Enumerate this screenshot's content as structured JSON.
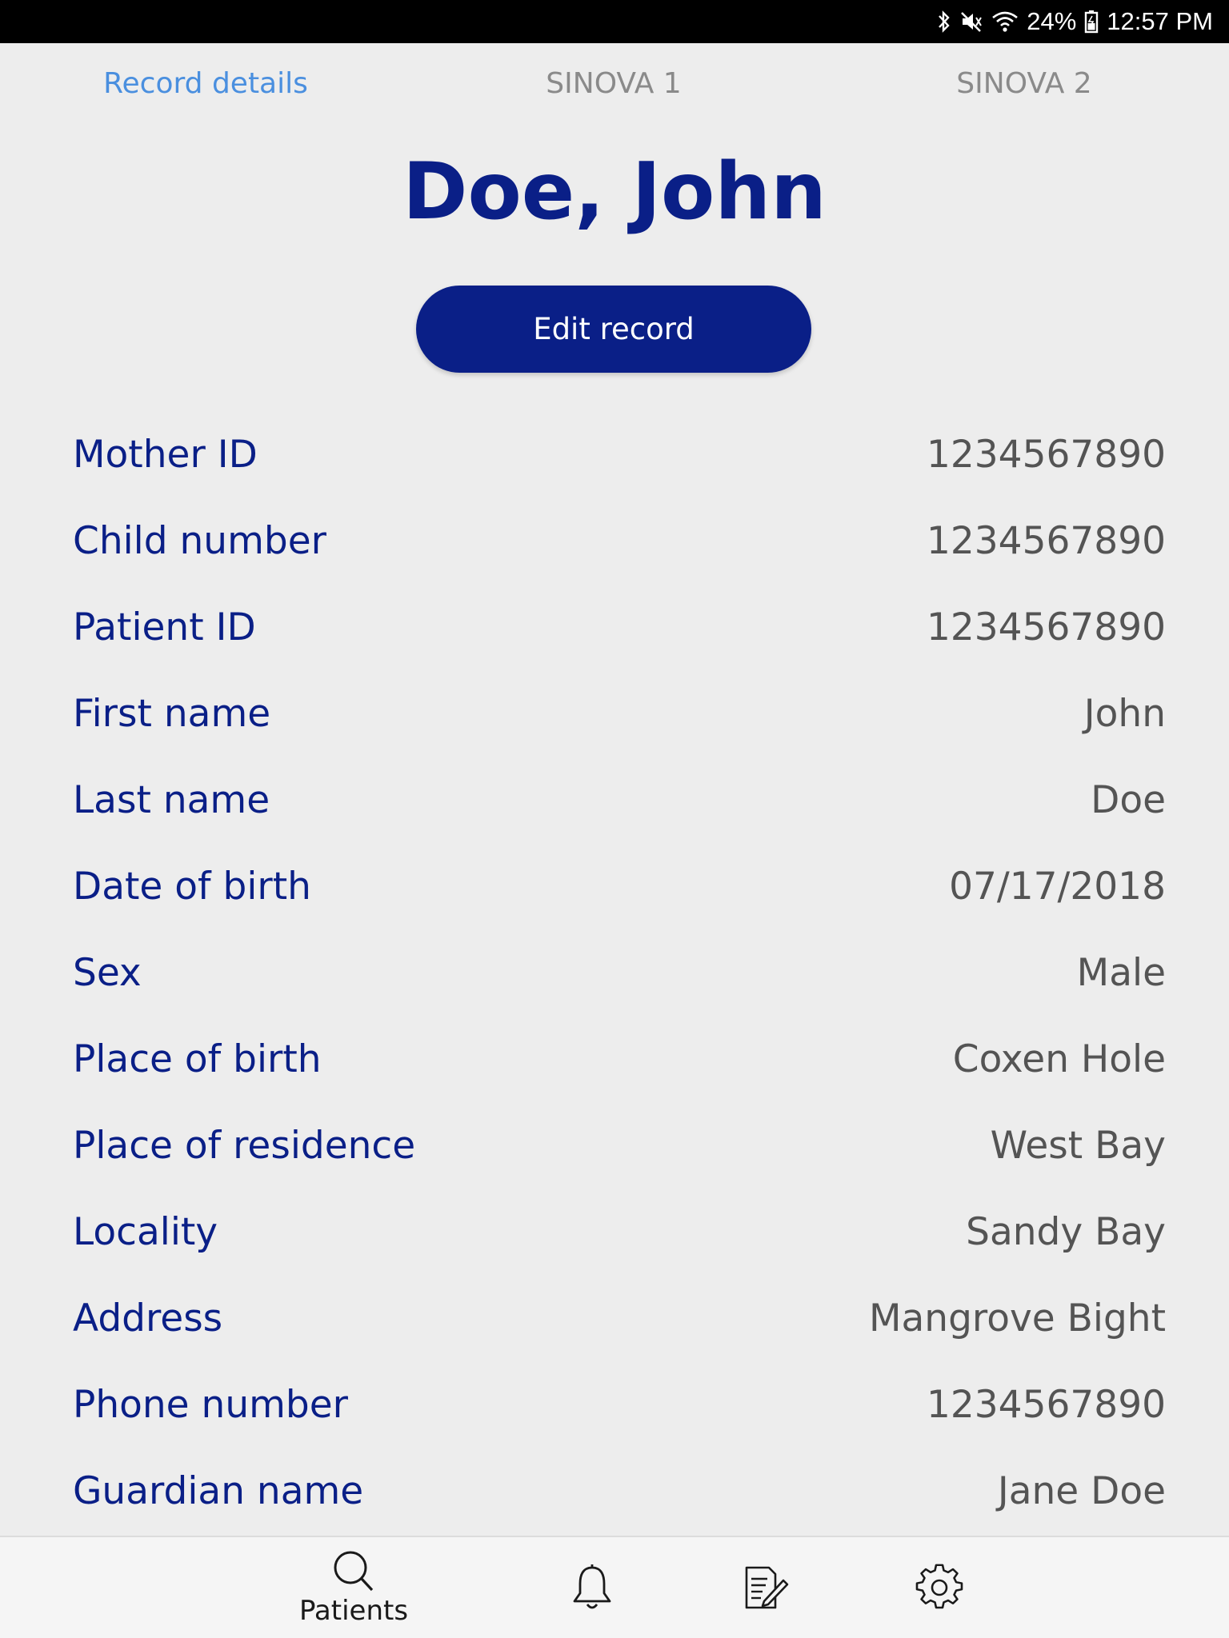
{
  "status_bar": {
    "battery": "24%",
    "time": "12:57 PM"
  },
  "tabs": [
    {
      "label": "Record details",
      "active": true
    },
    {
      "label": "SINOVA 1",
      "active": false
    },
    {
      "label": "SINOVA 2",
      "active": false
    }
  ],
  "record": {
    "title": "Doe, John",
    "edit_label": "Edit record"
  },
  "details": [
    {
      "label": "Mother ID",
      "value": "1234567890"
    },
    {
      "label": "Child number",
      "value": "1234567890"
    },
    {
      "label": "Patient ID",
      "value": "1234567890"
    },
    {
      "label": "First name",
      "value": "John"
    },
    {
      "label": "Last name",
      "value": "Doe"
    },
    {
      "label": "Date of birth",
      "value": "07/17/2018"
    },
    {
      "label": "Sex",
      "value": "Male"
    },
    {
      "label": "Place of birth",
      "value": "Coxen Hole"
    },
    {
      "label": "Place of residence",
      "value": "West Bay"
    },
    {
      "label": "Locality",
      "value": "Sandy Bay"
    },
    {
      "label": "Address",
      "value": "Mangrove Bight"
    },
    {
      "label": "Phone number",
      "value": "1234567890"
    },
    {
      "label": "Guardian name",
      "value": "Jane Doe"
    }
  ],
  "bottom_nav": {
    "patients_label": "Patients",
    "icons": [
      "search-icon",
      "bell-icon",
      "notes-icon",
      "gear-icon"
    ]
  },
  "colors": {
    "primary": "#0a1f87",
    "active_tab": "#4a8fdf",
    "inactive_tab": "#8a8a8a",
    "value_text": "#545454",
    "background": "#ededed"
  }
}
